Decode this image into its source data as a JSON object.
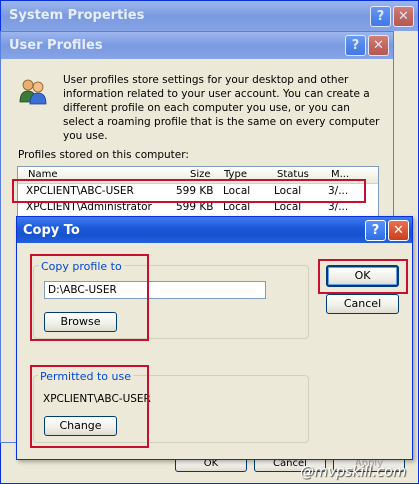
{
  "system_properties": {
    "title": "System Properties",
    "ok_label": "OK",
    "cancel_label": "Cancel",
    "apply_label": "Apply"
  },
  "user_profiles": {
    "title": "User Profiles",
    "description": "User profiles store settings for your desktop and other information related to your user account. You can create a different profile on each computer you use, or you can select a roaming profile that is the same on every computer you use.",
    "list_label": "Profiles stored on this computer:",
    "columns": [
      "Name",
      "Size",
      "Type",
      "Status",
      "M..."
    ],
    "rows": [
      {
        "name": "XPCLIENT\\ABC-USER",
        "size": "599 KB",
        "type": "Local",
        "status": "Local",
        "modified": "3/..."
      },
      {
        "name": "XPCLIENT\\Administrator",
        "size": "599 KB",
        "type": "Local",
        "status": "Local",
        "modified": "3/..."
      }
    ]
  },
  "copy_to": {
    "title": "Copy To",
    "copy_profile_label": "Copy profile to",
    "path_value": "D:\\ABC-USER",
    "browse_label": "Browse",
    "permitted_label": "Permitted to use",
    "permitted_user": "XPCLIENT\\ABC-USER",
    "change_label": "Change",
    "ok_label": "OK",
    "cancel_label": "Cancel"
  },
  "title_buttons": {
    "help": "?",
    "close": "✕"
  },
  "watermark": "@mvpskill.com",
  "colors": {
    "accent": "#0a5bd6",
    "highlight": "#c8102e",
    "window_face": "#ece9d8"
  }
}
